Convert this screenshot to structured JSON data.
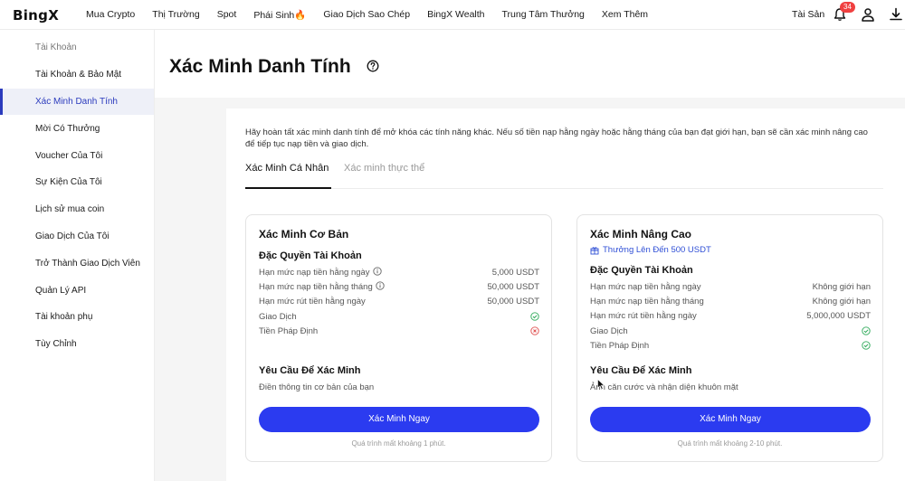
{
  "nav": {
    "logo": "BingX",
    "items": [
      "Mua Crypto",
      "Thị Trường",
      "Spot",
      "Phái Sinh🔥",
      "Giao Dịch Sao Chép",
      "BingX Wealth",
      "Trung Tâm Thưởng",
      "Xem Thêm"
    ],
    "assets": "Tài Sản",
    "notification_count": "34"
  },
  "sidebar": {
    "header": "Tài Khoản",
    "items": [
      {
        "label": "Tài Khoản & Bảo Mật"
      },
      {
        "label": "Xác Minh Danh Tính"
      },
      {
        "label": "Mời Có Thưởng"
      },
      {
        "label": "Voucher Của Tôi"
      },
      {
        "label": "Sự Kiện Của Tôi"
      },
      {
        "label": "Lịch sử mua coin"
      },
      {
        "label": "Giao Dịch Của Tôi"
      },
      {
        "label": "Trở Thành Giao Dịch Viên"
      },
      {
        "label": "Quản Lý API"
      },
      {
        "label": "Tài khoản phụ"
      },
      {
        "label": "Tùy Chỉnh"
      }
    ],
    "active": "Xác Minh Danh Tính"
  },
  "page": {
    "title": "Xác Minh Danh Tính",
    "intro": "Hãy hoàn tất xác minh danh tính để mở khóa các tính năng khác. Nếu số tiền nạp hằng ngày hoặc hằng tháng của bạn đạt giới hạn, bạn sẽ cần xác minh nâng cao để tiếp tục nạp tiền và giao dịch.",
    "tabs": [
      {
        "label": "Xác Minh Cá Nhân",
        "active": true
      },
      {
        "label": "Xác minh thực thể",
        "active": false
      }
    ]
  },
  "basic": {
    "title": "Xác Minh Cơ Bản",
    "privileges_title": "Đặc Quyền Tài Khoản",
    "rows": [
      {
        "label": "Hạn mức nạp tiền hằng ngày",
        "value": "5,000 USDT"
      },
      {
        "label": "Hạn mức nạp tiền hằng tháng",
        "value": "50,000 USDT"
      },
      {
        "label": "Hạn mức rút tiền hằng ngày",
        "value": "50,000 USDT"
      },
      {
        "label": "Giao Dịch",
        "value": ""
      },
      {
        "label": "Tiền Pháp Định",
        "value": ""
      }
    ],
    "requirements_title": "Yêu Cầu Để Xác Minh",
    "requirements_desc": "Điền thông tin cơ bản của bạn",
    "button": "Xác Minh Ngay",
    "note": "Quá trình mất khoảng 1 phút."
  },
  "advanced": {
    "title": "Xác Minh Nâng Cao",
    "reward": "Thưởng Lên Đến 500 USDT",
    "privileges_title": "Đặc Quyền Tài Khoản",
    "rows": [
      {
        "label": "Hạn mức nạp tiền hằng ngày",
        "value": "Không giới hạn"
      },
      {
        "label": "Hạn mức nạp tiền hằng tháng",
        "value": "Không giới hạn"
      },
      {
        "label": "Hạn mức rút tiền hằng ngày",
        "value": "5,000,000 USDT"
      },
      {
        "label": "Giao Dịch",
        "value": ""
      },
      {
        "label": "Tiền Pháp Định",
        "value": ""
      }
    ],
    "requirements_title": "Yêu Cầu Để Xác Minh",
    "requirements_desc": "Ảnh căn cước và nhận diện khuôn mặt",
    "button": "Xác Minh Ngay",
    "note": "Quá trình mất khoảng 2-10 phút."
  },
  "colors": {
    "accent": "#2b3bf0",
    "check": "#2faa5a",
    "cross": "#e05050",
    "badge": "#f04040"
  }
}
